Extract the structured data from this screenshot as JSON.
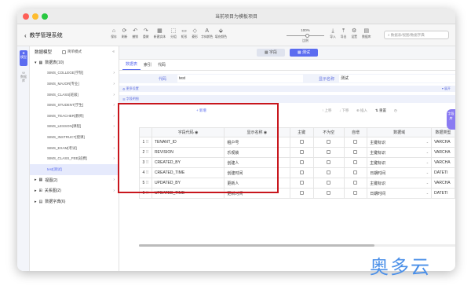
{
  "window": {
    "title": "当前项目为模板项目"
  },
  "header": {
    "app_title": "教学管理系统",
    "back_icon": "chevron-left-icon"
  },
  "toolbar": {
    "buttons": [
      {
        "label": "保存",
        "icon": "home-icon"
      },
      {
        "label": "刷新",
        "icon": "refresh-icon"
      },
      {
        "label": "撤销",
        "icon": "undo-icon"
      },
      {
        "label": "重做",
        "icon": "redo-icon"
      },
      {
        "label": "新建实体",
        "icon": "table-icon"
      },
      {
        "label": "分组",
        "icon": "group-icon"
      },
      {
        "label": "矩形",
        "icon": "rect-icon"
      },
      {
        "label": "菱形",
        "icon": "diamond-icon"
      },
      {
        "label": "字体颜色",
        "icon": "font-color-icon"
      },
      {
        "label": "填充颜色",
        "icon": "fill-icon"
      }
    ],
    "zoom": {
      "value": "100%",
      "label": "比例"
    },
    "buttons_right": [
      {
        "label": "导入",
        "icon": "import-icon"
      },
      {
        "label": "导出",
        "icon": "export-icon"
      },
      {
        "label": "设置",
        "icon": "gear-icon"
      },
      {
        "label": "数据库",
        "icon": "database-icon"
      }
    ],
    "search_placeholder": "数据表/视图/数据字典"
  },
  "rail": {
    "model": "模型",
    "database": "数据库"
  },
  "sidebar": {
    "header": "数据模型",
    "simple_mode": "简单模式",
    "group_tables": "数据表(10)",
    "tables": [
      "SIMS_COLLEGE[学院]",
      "SIMS_MAJOR[专业]",
      "SIMS_CLASS[班级]",
      "SIMS_STUDENT[学生]",
      "SIMS_TEACHER[教师]",
      "SIMS_LESSON[课程]",
      "SIMS_INSTRUCT[授课]",
      "SIMS_EXAM[考试]",
      "SIMS_CLASS_FEE[班费]",
      "test[测试]"
    ],
    "group_views": "视图(2)",
    "group_relations": "关系图(2)",
    "group_dicts": "数据字典(6)"
  },
  "main": {
    "mode_field": "字段",
    "mode_test": "测试",
    "tabs": [
      "数据表",
      "索引",
      "代码"
    ],
    "code_label": "代码",
    "code_value": "test",
    "display_label": "显示名称",
    "display_value": "测试",
    "more_settings": "更多设置",
    "expand": "展开",
    "field_details": "字段明细",
    "field_toolbar": [
      "新增",
      "上移",
      "下移",
      "插入",
      "删除",
      "重置"
    ],
    "columns": [
      "字段代码",
      "显示名称",
      "主键",
      "不为空",
      "自增",
      "数据域",
      "数据类型"
    ],
    "rows": [
      {
        "no": "1",
        "code": "TENANT_ID",
        "name": "租户号",
        "domain": "主键标识",
        "type": "VARCHA"
      },
      {
        "no": "2",
        "code": "REVISION",
        "name": "乐观锁",
        "domain": "主键标识",
        "type": "VARCHA"
      },
      {
        "no": "3",
        "code": "CREATED_BY",
        "name": "创建人",
        "domain": "主键标识",
        "type": "VARCHA"
      },
      {
        "no": "4",
        "code": "CREATED_TIME",
        "name": "创建时间",
        "domain": "日期时间",
        "type": "DATETI"
      },
      {
        "no": "5",
        "code": "UPDATED_BY",
        "name": "更新人",
        "domain": "主键标识",
        "type": "VARCHA"
      },
      {
        "no": "6",
        "code": "UPDATED_TIME",
        "name": "更新时间",
        "domain": "日期时间",
        "type": "DATETI"
      }
    ]
  },
  "assistant": "字段库",
  "watermark": "奥多云",
  "colors": {
    "accent": "#5b6cf0",
    "highlight": "#c8161d",
    "watermark": "#4a8fe8"
  }
}
